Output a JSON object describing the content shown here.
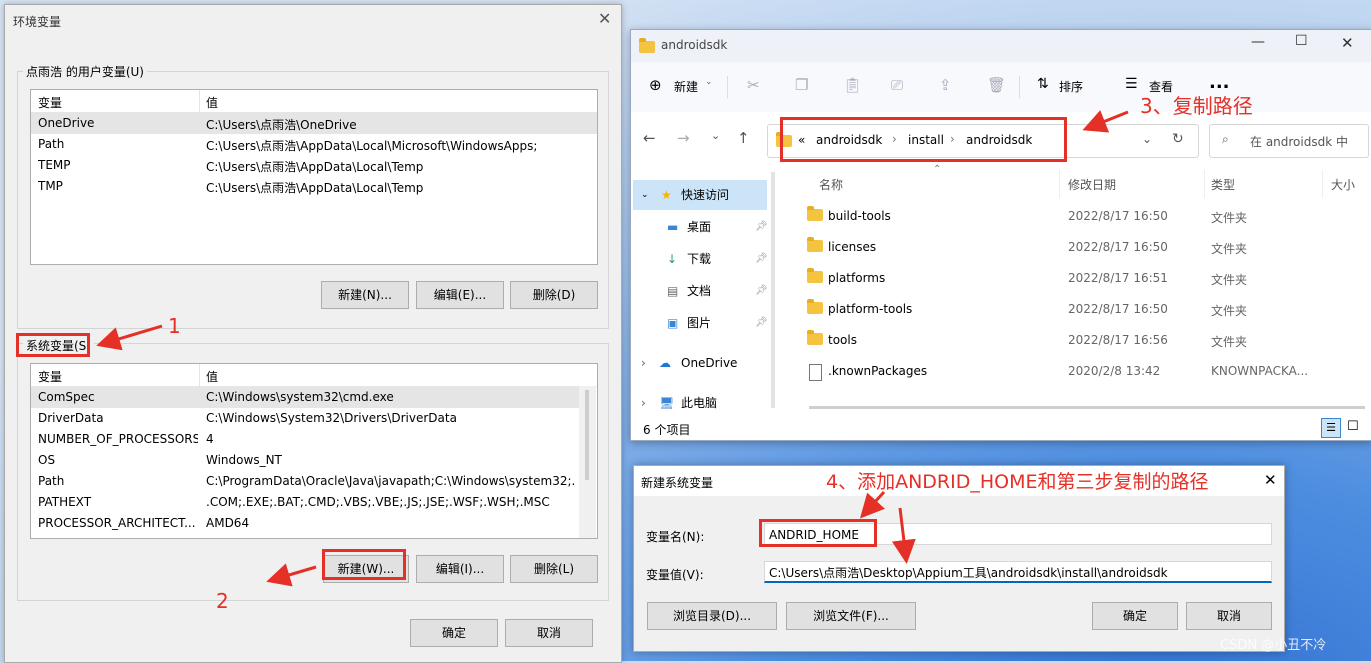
{
  "env_dialog": {
    "title": "环境变量",
    "user_group_label": "点雨浩 的用户变量(U)",
    "system_group_label": "系统变量(S)",
    "col_variable": "变量",
    "col_value": "值",
    "user_vars": [
      {
        "name": "OneDrive",
        "value": "C:\\Users\\点雨浩\\OneDrive"
      },
      {
        "name": "Path",
        "value": "C:\\Users\\点雨浩\\AppData\\Local\\Microsoft\\WindowsApps;"
      },
      {
        "name": "TEMP",
        "value": "C:\\Users\\点雨浩\\AppData\\Local\\Temp"
      },
      {
        "name": "TMP",
        "value": "C:\\Users\\点雨浩\\AppData\\Local\\Temp"
      }
    ],
    "system_vars": [
      {
        "name": "ComSpec",
        "value": "C:\\Windows\\system32\\cmd.exe"
      },
      {
        "name": "DriverData",
        "value": "C:\\Windows\\System32\\Drivers\\DriverData"
      },
      {
        "name": "NUMBER_OF_PROCESSORS",
        "value": "4"
      },
      {
        "name": "OS",
        "value": "Windows_NT"
      },
      {
        "name": "Path",
        "value": "C:\\ProgramData\\Oracle\\Java\\javapath;C:\\Windows\\system32;..."
      },
      {
        "name": "PATHEXT",
        "value": ".COM;.EXE;.BAT;.CMD;.VBS;.VBE;.JS;.JSE;.WSF;.WSH;.MSC"
      },
      {
        "name": "PROCESSOR_ARCHITECT...",
        "value": "AMD64"
      }
    ],
    "user_buttons": {
      "new": "新建(N)...",
      "edit": "编辑(E)...",
      "delete": "删除(D)"
    },
    "system_buttons": {
      "new": "新建(W)...",
      "edit": "编辑(I)...",
      "delete": "删除(L)"
    },
    "ok": "确定",
    "cancel": "取消"
  },
  "explorer": {
    "title": "androidsdk",
    "toolbar": {
      "new": "新建",
      "sort": "排序",
      "view": "查看",
      "more": "..."
    },
    "breadcrumb": [
      "«",
      "androidsdk",
      "install",
      "androidsdk"
    ],
    "search_placeholder": "在 androidsdk 中",
    "columns": {
      "name": "名称",
      "modified": "修改日期",
      "type": "类型",
      "size": "大小"
    },
    "nav": {
      "quick_access": "快速访问",
      "desktop": "桌面",
      "downloads": "下载",
      "documents": "文档",
      "pictures": "图片",
      "onedrive": "OneDrive",
      "this_pc": "此电脑"
    },
    "files": [
      {
        "name": "build-tools",
        "modified": "2022/8/17 16:50",
        "type": "文件夹",
        "kind": "folder"
      },
      {
        "name": "licenses",
        "modified": "2022/8/17 16:50",
        "type": "文件夹",
        "kind": "folder"
      },
      {
        "name": "platforms",
        "modified": "2022/8/17 16:51",
        "type": "文件夹",
        "kind": "folder"
      },
      {
        "name": "platform-tools",
        "modified": "2022/8/17 16:50",
        "type": "文件夹",
        "kind": "folder"
      },
      {
        "name": "tools",
        "modified": "2022/8/17 16:56",
        "type": "文件夹",
        "kind": "folder"
      },
      {
        "name": ".knownPackages",
        "modified": "2020/2/8 13:42",
        "type": "KNOWNPACKA...",
        "kind": "file"
      }
    ],
    "status": "6 个项目"
  },
  "new_var_dialog": {
    "title": "新建系统变量",
    "name_label": "变量名(N):",
    "value_label": "变量值(V):",
    "name_value": "ANDRID_HOME",
    "value_value": "C:\\Users\\点雨浩\\Desktop\\Appium工具\\androidsdk\\install\\androidsdk",
    "browse_dir": "浏览目录(D)...",
    "browse_file": "浏览文件(F)...",
    "ok": "确定",
    "cancel": "取消"
  },
  "annotations": {
    "step1": "1",
    "step2": "2",
    "step3": "3、复制路径",
    "step4": "4、添加ANDRID_HOME和第三步复制的路径"
  },
  "watermark": "CSDN @小丑不冷",
  "colors": {
    "annotation_red": "#e53027",
    "selection_blue": "#cce4f7",
    "folder_yellow": "#f4c340"
  }
}
